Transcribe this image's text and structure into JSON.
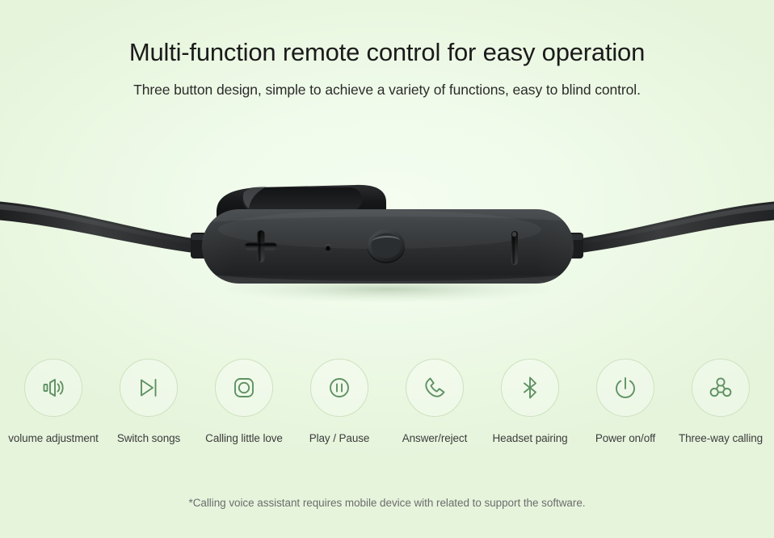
{
  "header": {
    "title": "Multi-function remote control for easy operation",
    "subtitle": "Three button design, simple to achieve a variety of functions, easy to blind control."
  },
  "product": {
    "name": "bluetooth-earphone-remote-control",
    "description": "Black inline three-button remote control with cable on both sides",
    "controls": {
      "volume_up": "+",
      "volume_down": "|",
      "center_button": "circle",
      "microphone": "pinhole"
    }
  },
  "features": [
    {
      "label": "volume adjustment",
      "icon": "volume-icon"
    },
    {
      "label": "Switch songs",
      "icon": "skip-next-icon"
    },
    {
      "label": "Calling little love",
      "icon": "voice-assistant-icon"
    },
    {
      "label": "Play / Pause",
      "icon": "play-pause-icon"
    },
    {
      "label": "Answer/reject",
      "icon": "phone-icon"
    },
    {
      "label": "Headset pairing",
      "icon": "bluetooth-icon"
    },
    {
      "label": "Power on/off",
      "icon": "power-icon"
    },
    {
      "label": "Three-way calling",
      "icon": "three-way-calling-icon"
    }
  ],
  "footnote": "*Calling voice assistant requires mobile device with related to support the software.",
  "colors": {
    "background_center": "#f4fdf0",
    "background_edge": "#e6f4dc",
    "icon_stroke": "#5f9163",
    "circle_border": "#cde2bf",
    "title_text": "#1b1b1b",
    "label_text": "#3c3c3c",
    "footnote_text": "#6d6d6d",
    "device_body": "#2d2f30"
  }
}
